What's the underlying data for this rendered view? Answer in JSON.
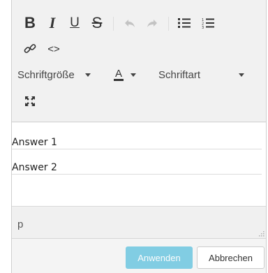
{
  "toolbar": {
    "row1": [
      {
        "name": "bold-button",
        "label": "B",
        "icon": "bold-icon"
      },
      {
        "name": "italic-button",
        "label": "I",
        "icon": "italic-icon"
      },
      {
        "name": "underline-button",
        "label": "U",
        "icon": "underline-icon"
      },
      {
        "name": "strikethrough-button",
        "label": "S",
        "icon": "strikethrough-icon"
      },
      {
        "name": "undo-button",
        "icon": "undo-icon",
        "disabled": true
      },
      {
        "name": "redo-button",
        "icon": "redo-icon",
        "disabled": true
      },
      {
        "name": "bullet-list-button",
        "icon": "bullet-list-icon"
      },
      {
        "name": "numbered-list-button",
        "icon": "numbered-list-icon"
      }
    ],
    "row2": [
      {
        "name": "link-button",
        "icon": "link-icon"
      },
      {
        "name": "source-code-button",
        "label": "<>",
        "icon": "code-icon"
      }
    ],
    "font_size_label": "Schriftgröße",
    "text_color_label": "A",
    "text_color_icon": "text-color-icon",
    "font_family_label": "Schriftart",
    "fullscreen_icon": "fullscreen-icon"
  },
  "content": {
    "lines": [
      "Answer 1",
      "Answer 2"
    ]
  },
  "statusbar": {
    "path": "p",
    "resize_icon": "resize-grip-icon"
  },
  "footer": {
    "apply_label": "Anwenden",
    "cancel_label": "Abbrechen"
  },
  "colors": {
    "accent": "#5bc0de",
    "toolbar_bg": "#f1f1f1",
    "disabled_icon": "#c3c3c3"
  }
}
